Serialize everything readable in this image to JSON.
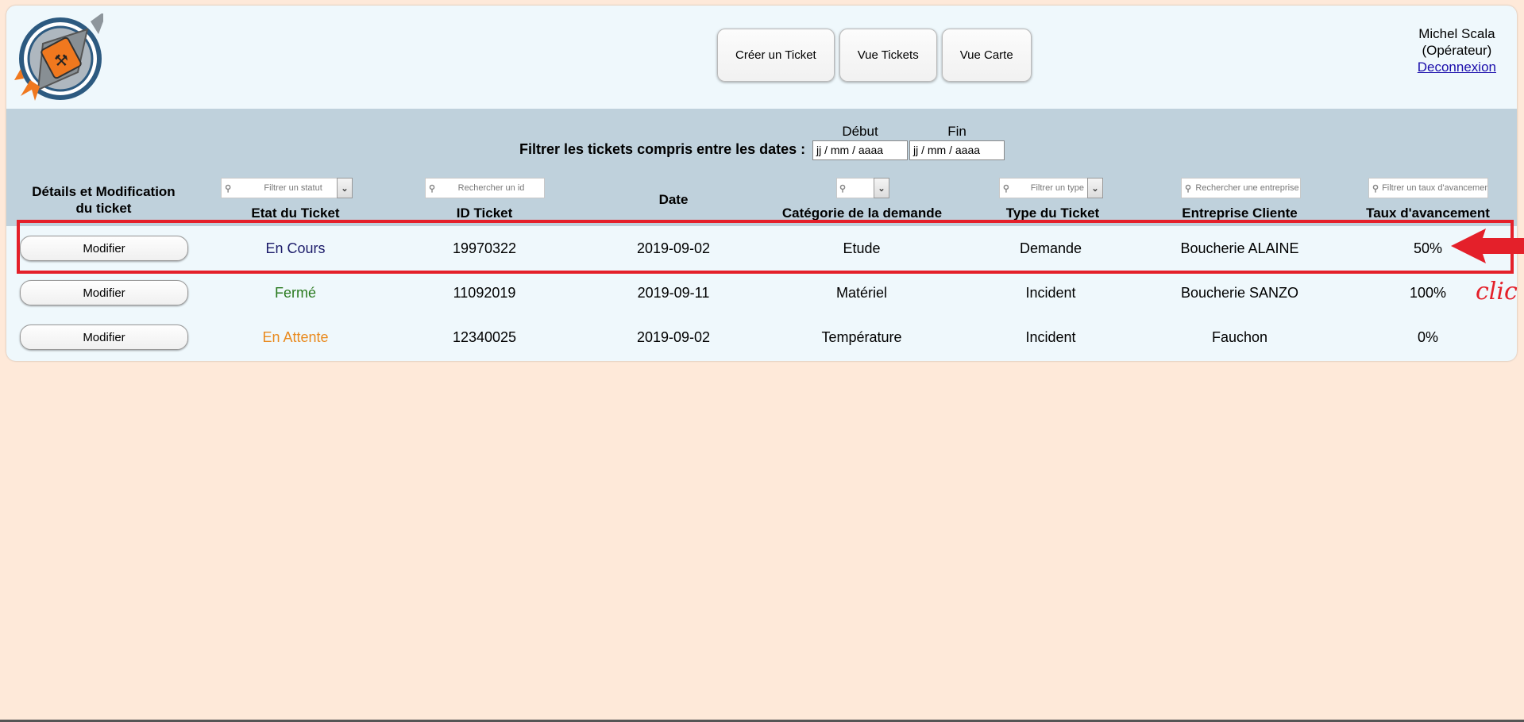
{
  "header": {
    "logo_alt": "TICKET SHIP",
    "nav": [
      {
        "label": "Créer un Ticket"
      },
      {
        "label": "Vue Tickets"
      },
      {
        "label": "Vue Carte"
      }
    ],
    "user": {
      "name": "Michel Scala",
      "role": "(Opérateur)",
      "logout_label": "Deconnexion"
    }
  },
  "date_filter": {
    "label": "Filtrer les tickets compris entre les dates :",
    "start_caption": "Début",
    "end_caption": "Fin",
    "start_value": "jj / mm / aaaa",
    "end_value": "jj / mm / aaaa"
  },
  "table": {
    "columns": {
      "details": {
        "title_line1": "Détails et Modification",
        "title_line2": "du ticket"
      },
      "status": {
        "title": "Etat du Ticket",
        "filter_placeholder": "Filtrer un statut"
      },
      "id": {
        "title": "ID Ticket",
        "filter_placeholder": "Rechercher un id"
      },
      "date": {
        "title": "Date"
      },
      "category": {
        "title": "Catégorie de la demande",
        "filter_placeholder": ""
      },
      "type": {
        "title": "Type du Ticket",
        "filter_placeholder": "Filtrer un type"
      },
      "company": {
        "title": "Entreprise Cliente",
        "filter_placeholder": "Rechercher une entreprise"
      },
      "progress": {
        "title": "Taux d'avancement",
        "filter_placeholder": "Filtrer un taux d'avancement"
      }
    },
    "rows": [
      {
        "action": "Modifier",
        "status": "En Cours",
        "status_color": "#1c1c6a",
        "id": "19970322",
        "date": "2019-09-02",
        "category": "Etude",
        "type": "Demande",
        "company": "Boucherie ALAINE",
        "progress": "50%"
      },
      {
        "action": "Modifier",
        "status": "Fermé",
        "status_color": "#2a7a1f",
        "id": "11092019",
        "date": "2019-09-11",
        "category": "Matériel",
        "type": "Incident",
        "company": "Boucherie SANZO",
        "progress": "100%"
      },
      {
        "action": "Modifier",
        "status": "En Attente",
        "status_color": "#e98a1e",
        "id": "12340025",
        "date": "2019-09-02",
        "category": "Température",
        "type": "Incident",
        "company": "Fauchon",
        "progress": "0%"
      }
    ]
  },
  "annotation": {
    "label": "clic",
    "color": "#e4202a"
  },
  "colors": {
    "page_background": "#fee9d9",
    "panel_background": "#eff8fc",
    "table_header_background": "#bfd1dc"
  }
}
